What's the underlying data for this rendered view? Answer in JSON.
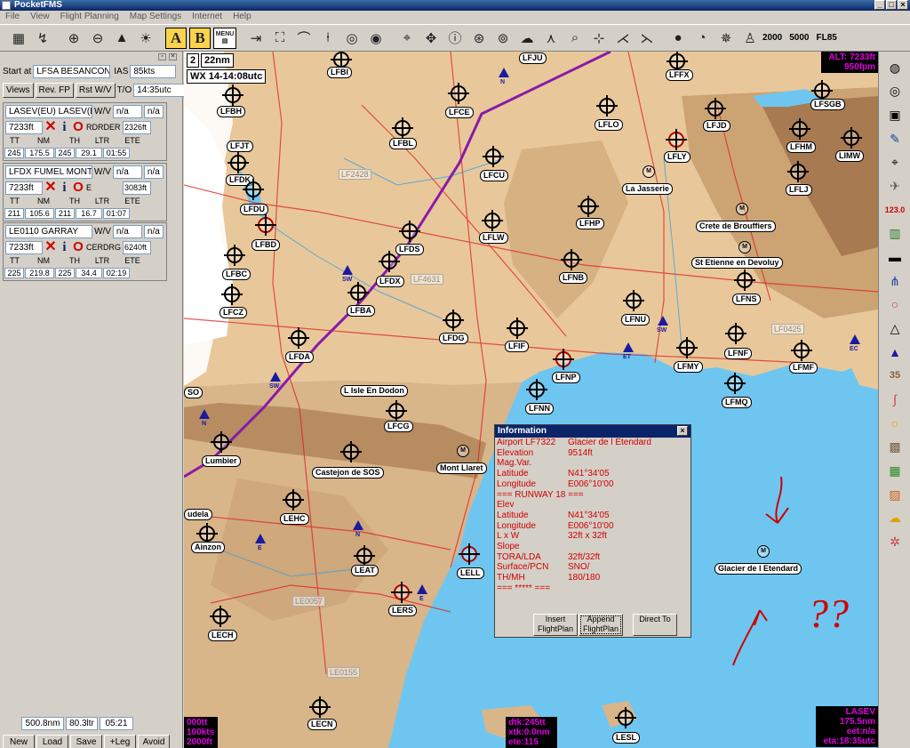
{
  "app": {
    "title": "PocketFMS"
  },
  "window_buttons": [
    "_",
    "□",
    "×"
  ],
  "menu": [
    "File",
    "View",
    "Flight Planning",
    "Map Settings",
    "Internet",
    "Help"
  ],
  "toolbar": {
    "left_icons": [
      "map-grid-icon",
      "route-icon",
      "zoom-in-icon",
      "zoom-out-icon",
      "terrain-icon",
      "sun-icon"
    ],
    "a_label": "A",
    "b_label": "B",
    "menu_label": "MENU",
    "nav_icons": [
      "compress-icon",
      "expand-icon",
      "antenna-icon",
      "tower-icon",
      "ndb-icon",
      "vor-icon",
      "center-icon",
      "move-icon",
      "info-icon",
      "lifebuoy-icon",
      "waypoint-icon",
      "weather-icon",
      "route-split-icon",
      "add-point-icon",
      "target-icon",
      "add-leg-icon",
      "remove-leg-icon",
      "helmet-icon",
      "gauge-icon",
      "compass-icon",
      "pilot-icon"
    ],
    "altitude_buttons": [
      "2000",
      "5000",
      "FL85"
    ]
  },
  "flightplan": {
    "start_label": "Start at",
    "start_value": "LFSA BESANCON",
    "ias_label": "IAS",
    "ias_value": "85kts",
    "views_btn": "Views",
    "rev_btn": "Rev. FP",
    "rst_btn": "Rst W/V",
    "to_label": "T/O",
    "to_value": "14:35utc",
    "col_headers": [
      "TT",
      "NM",
      "TH",
      "LTR",
      "ETE"
    ],
    "wv_label": "W/V",
    "legs": [
      {
        "route": "LASEV(EU) LASEV(EU)",
        "wv1": "n/a",
        "wv2": "n/a",
        "alt": "7233ft",
        "note": "RDRDER",
        "max": "2326ft",
        "tt": "245",
        "nm": "175.5",
        "th": "245",
        "ltr": "29.1",
        "ete": "01:55"
      },
      {
        "route": "LFDX FUMEL MONTAYR",
        "wv1": "n/a",
        "wv2": "n/a",
        "alt": "7233ft",
        "note": "E",
        "max": "3083ft",
        "tt": "211",
        "nm": "105.6",
        "th": "211",
        "ltr": "16.7",
        "ete": "01:07"
      },
      {
        "route": "LE0110 GARRAY",
        "wv1": "n/a",
        "wv2": "n/a",
        "alt": "7233ft",
        "note": "CERDRG",
        "max": "6240ft",
        "tt": "225",
        "nm": "219.8",
        "th": "225",
        "ltr": "34.4",
        "ete": "02:19"
      }
    ],
    "totals": {
      "nm": "500.8nm",
      "ltr": "80.3ltr",
      "time": "05:21"
    },
    "buttons": [
      "New",
      "Load",
      "Save",
      "+Leg",
      "Avoid"
    ]
  },
  "map": {
    "zoom_level": "2",
    "scale": "22nm",
    "wx": "WX 14-14:08utc",
    "top_right": {
      "alt": "ALT: 7233ft",
      "rate": "950fpm"
    },
    "bottom_left": [
      "000tt",
      "100kts",
      "2000ft"
    ],
    "bottom_center": [
      "dtk:245tt",
      "xtk:0.0nm",
      "ete:115"
    ],
    "bottom_right": [
      "LASEV",
      "175.5nm",
      "eet:n/a",
      "eta:18:35utc"
    ],
    "airports": [
      "LFBI",
      "LFJU",
      "LFFX",
      "LFSGB",
      "LFBH",
      "LFCE",
      "LFLO",
      "LFJD",
      "LFJT",
      "LFBL",
      "LFLY",
      "LFHM",
      "LIMW",
      "LFDK",
      "LFCU",
      "LFLJ",
      "LFDU",
      "LFHP",
      "LFBD",
      "LFLW",
      "LFDS",
      "LFBC",
      "LFDX",
      "LFNB",
      "LFNS",
      "LFCZ",
      "LFBA",
      "LFNU",
      "LFDG",
      "LFIF",
      "LFNF",
      "LFDA",
      "LFMY",
      "LFMF",
      "LFNP",
      "LFMQ",
      "LFNN",
      "LFCG",
      "LEHC",
      "LEAT",
      "LELL",
      "LERS",
      "LECH",
      "LECN",
      "LESL",
      "Lumbier",
      "Castejon de SOS",
      "Mont Llaret",
      "Ainzon",
      "udela",
      "SO"
    ],
    "places": [
      "La Jasserie",
      "Crete de Brouffiers",
      "St Etienne en Devoluy",
      "L Isle En Dodon",
      "Glacier de l Etendard"
    ],
    "zones": [
      "LF2428",
      "LF4631",
      "LF0425",
      "LE0057",
      "LE0155"
    ],
    "vors": [
      "N",
      "SW",
      "ET",
      "SW",
      "EC",
      "SW",
      "N",
      "N",
      "E",
      "E"
    ],
    "annotation": "??"
  },
  "info_dialog": {
    "title": "Information",
    "lines": [
      {
        "k": "Airport LF7322",
        "v": "Glacier de l Etendard"
      },
      {
        "k": "Elevation",
        "v": "9514ft"
      },
      {
        "k": "Mag.Var.",
        "v": ""
      },
      {
        "k": "Latitude",
        "v": "N41°34'05"
      },
      {
        "k": "Longitude",
        "v": "E006°10'00"
      },
      {
        "k": "=== RUNWAY 18 ===",
        "v": ""
      },
      {
        "k": "Elev",
        "v": ""
      },
      {
        "k": "Latitude",
        "v": "N41°34'05"
      },
      {
        "k": "Longitude",
        "v": "E006°10'00"
      },
      {
        "k": "L x W",
        "v": "32ft x 32ft"
      },
      {
        "k": "Slope",
        "v": ""
      },
      {
        "k": "TORA/LDA",
        "v": "32ft/32ft"
      },
      {
        "k": "Surface/PCN",
        "v": "SNO/"
      },
      {
        "k": "TH/MH",
        "v": "180/180"
      },
      {
        "k": "=== ***** ===",
        "v": ""
      }
    ],
    "buttons": [
      "Insert FlightPlan",
      "Append FlightPlan",
      "Direct To"
    ]
  },
  "right_toolbar": {
    "icons": [
      "globe-icon",
      "circle-target-icon",
      "square-icon",
      "pen-icon",
      "crosshair-icon",
      "plane-icon",
      "frequency-icon",
      "map-icon",
      "ruler-icon",
      "fork-icon",
      "ring-icon",
      "triangle-outline-icon",
      "triangle-filled-icon",
      "number-icon",
      "curve-icon",
      "circle-yellow-icon",
      "grid-icon",
      "map-green-icon",
      "map-colored-icon",
      "weather-cloud-icon",
      "gear-red-icon"
    ],
    "freq_label": "123.0",
    "number_label": "35"
  }
}
